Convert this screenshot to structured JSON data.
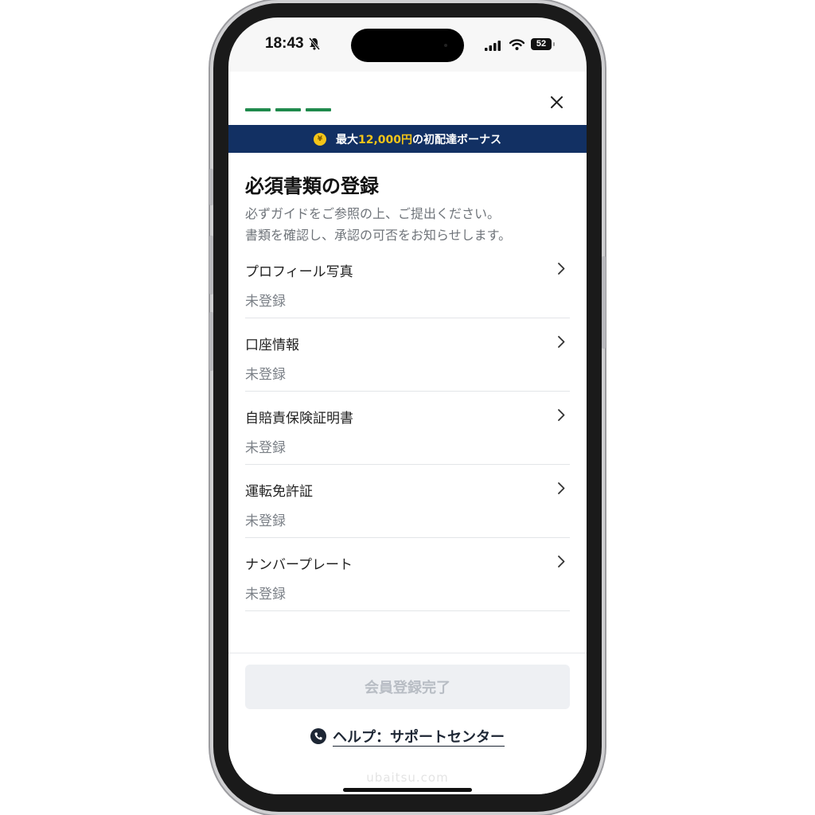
{
  "status_bar": {
    "time": "18:43",
    "battery_level": "52",
    "icons": [
      "bell-slash-icon",
      "signal-icon",
      "wifi-icon",
      "battery-icon"
    ]
  },
  "header": {
    "progress_steps": 3,
    "close_icon": "close-icon"
  },
  "banner": {
    "prefix": "最大",
    "amount": "12,000円",
    "suffix": "の初配達ボーナス",
    "icon": "coin-yen-icon",
    "colors": {
      "background": "#123063",
      "accent": "#f5c518"
    }
  },
  "page": {
    "title": "必須書類の登録",
    "description_line1": "必ずガイドをご参照の上、ご提出ください。",
    "description_line2": "書類を確認し、承認の可否をお知らせします。"
  },
  "documents": [
    {
      "label": "プロフィール写真",
      "status": "未登録"
    },
    {
      "label": "口座情報",
      "status": "未登録"
    },
    {
      "label": "自賠責保険証明書",
      "status": "未登録"
    },
    {
      "label": "運転免許証",
      "status": "未登録"
    },
    {
      "label": "ナンバープレート",
      "status": "未登録"
    }
  ],
  "footer": {
    "complete_button": "会員登録完了",
    "help_link": "ヘルプ：サポートセンター",
    "help_icon": "phone-icon"
  },
  "watermark": "ubaitsu.com",
  "theme": {
    "progress_color": "#1f8a4c"
  }
}
